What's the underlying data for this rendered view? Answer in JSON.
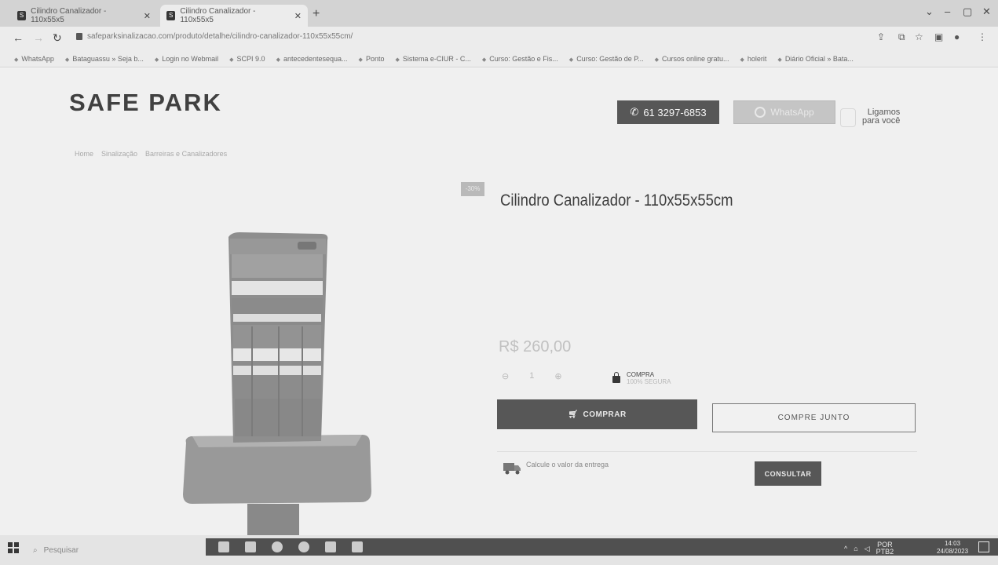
{
  "browser": {
    "tabs": [
      {
        "title": "Cilindro Canalizador - 110x55x5"
      },
      {
        "title": "Cilindro Canalizador - 110x55x5"
      }
    ],
    "url": "safeparksinalizacao.com/produto/detalhe/cilindro-canalizador-110x55x55cm/",
    "bookmarks": [
      "WhatsApp",
      "Bataguassu » Seja b...",
      "Login no Webmail",
      "SCPI 9.0",
      "antecedentesequa...",
      "Ponto",
      "Sistema e-CIUR - C...",
      "Curso: Gestão e Fis...",
      "Curso: Gestão de P...",
      "Cursos online gratu...",
      "holerit",
      "Diário Oficial » Bata..."
    ]
  },
  "header": {
    "logo": "SAFE PARK",
    "phone": "61 3297-6853",
    "whatsapp": "WhatsApp",
    "callback_line1": "Ligamos",
    "callback_line2": "para você"
  },
  "breadcrumb": [
    "Home",
    "Sinalização",
    "Barreiras e Canalizadores"
  ],
  "product": {
    "badge": "-30%",
    "title": "Cilindro Canalizador - 110x55x55cm",
    "price": "R$ 260,00",
    "qty": "1",
    "secure_line1": "COMPRA",
    "secure_line2": "100% SEGURA",
    "buy_label": "COMPRAR",
    "buy_together_label": "COMPRE JUNTO"
  },
  "shipping": {
    "label": "Calcule o valor da entrega",
    "button": "CONSULTAR"
  },
  "taskbar": {
    "search_placeholder": "Pesquisar",
    "lang_top": "POR",
    "lang_bottom": "PTB2",
    "time": "14:03",
    "date": "24/08/2023"
  }
}
